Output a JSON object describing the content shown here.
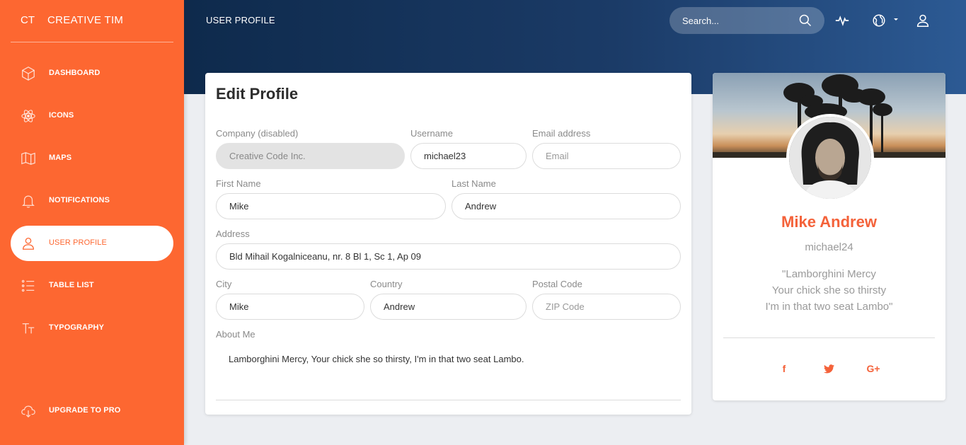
{
  "brand": {
    "mini": "CT",
    "name": "CREATIVE TIM"
  },
  "sidebar": {
    "items": [
      {
        "label": "DASHBOARD",
        "icon": "cube-icon"
      },
      {
        "label": "ICONS",
        "icon": "atom-icon"
      },
      {
        "label": "MAPS",
        "icon": "map-icon"
      },
      {
        "label": "NOTIFICATIONS",
        "icon": "bell-icon"
      },
      {
        "label": "USER PROFILE",
        "icon": "user-icon",
        "active": true
      },
      {
        "label": "TABLE LIST",
        "icon": "list-icon"
      },
      {
        "label": "TYPOGRAPHY",
        "icon": "text-icon"
      }
    ],
    "upgrade": {
      "label": "UPGRADE TO PRO",
      "icon": "cloud-download-icon"
    }
  },
  "header": {
    "title": "USER PROFILE",
    "search_placeholder": "Search...",
    "icons": [
      "search-icon",
      "pulse-icon",
      "globe-icon",
      "user-icon"
    ]
  },
  "edit_profile": {
    "title": "Edit Profile",
    "company": {
      "label": "Company (disabled)",
      "value": "Creative Code Inc."
    },
    "username": {
      "label": "Username",
      "value": "michael23"
    },
    "email": {
      "label": "Email address",
      "placeholder": "Email"
    },
    "first_name": {
      "label": "First Name",
      "value": "Mike"
    },
    "last_name": {
      "label": "Last Name",
      "value": "Andrew"
    },
    "address": {
      "label": "Address",
      "value": "Bld Mihail Kogalniceanu, nr. 8 Bl 1, Sc 1, Ap 09"
    },
    "city": {
      "label": "City",
      "value": "Mike"
    },
    "country": {
      "label": "Country",
      "value": "Andrew"
    },
    "postal": {
      "label": "Postal Code",
      "placeholder": "ZIP Code"
    },
    "about": {
      "label": "About Me",
      "value": "Lamborghini Mercy, Your chick she so thirsty, I'm in that two seat Lambo."
    }
  },
  "user_card": {
    "name": "Mike Andrew",
    "handle": "michael24",
    "quote_lines": [
      "\"Lamborghini Mercy",
      "Your chick she so thirsty",
      "I'm in that two seat Lambo\""
    ],
    "social": [
      {
        "icon": "facebook-icon",
        "glyph": "f"
      },
      {
        "icon": "twitter-icon",
        "glyph": ""
      },
      {
        "icon": "google-plus-icon",
        "glyph": "G+"
      }
    ]
  },
  "colors": {
    "accent": "#fd6731",
    "header_dark": "#0e2a4c",
    "header_light": "#2c5a94"
  }
}
